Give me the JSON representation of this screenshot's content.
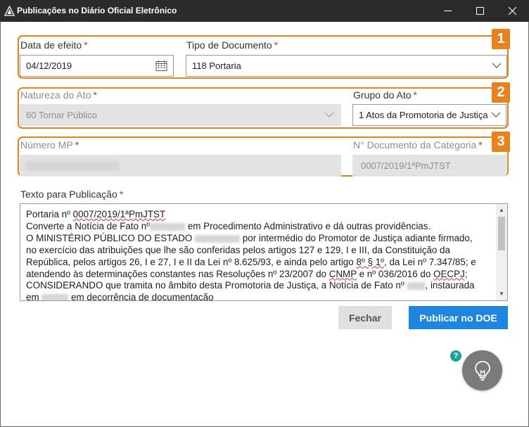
{
  "window": {
    "title": "Publicações no Diário Oficial Eletrônico",
    "icons": {
      "app": "app-logo-icon",
      "minimize": "minimize-icon",
      "maximize": "maximize-icon",
      "close": "close-icon"
    }
  },
  "section1": {
    "badge": "1",
    "data_efeito": {
      "label": "Data de efeito",
      "required_mark": "*",
      "value": "04/12/2019",
      "icon": "calendar-icon"
    },
    "tipo_documento": {
      "label": "Tipo de Documento",
      "required_mark": "*",
      "value": "118 Portaria",
      "icon": "chevron-down-icon"
    }
  },
  "section2": {
    "badge": "2",
    "natureza_ato": {
      "label": "Natureza do Ato",
      "required_mark": "*",
      "value": "60 Tornar Público",
      "icon": "chevron-down-icon"
    },
    "grupo_ato": {
      "label": "Grupo do Ato",
      "required_mark": "*",
      "value": "1 Atos da Promotoria de Justiça",
      "icon": "chevron-down-icon"
    }
  },
  "section3": {
    "badge": "3",
    "numero_mp": {
      "label": "Número MP",
      "required_mark": "*"
    },
    "documento_categoria": {
      "label": "N° Documento da Categoria",
      "required_mark": "*",
      "value": "0007/2019/1ªPmJTST"
    }
  },
  "texto": {
    "label": "Texto para Publicação",
    "required_mark": "*",
    "line1": {
      "a": "Portaria nº ",
      "b": "0007/2019/1ªPmJTST"
    },
    "line2": {
      "a": "Converte a Notícia de Fato nº",
      "b": " em Procedimento Administrativo e dá outras providências."
    },
    "line3": {
      "a": "O MINISTÉRIO PÚBLICO DO ESTADO ",
      "b": " por intermédio do Promotor de Justiça adiante firmado,"
    },
    "line4": "no exercício das atribuições que lhe são conferidas pelos artigos 127 e 129, I e III, da Constituição da",
    "line5": {
      "a": "República, pelos artigos 26, I e 27, I e II da Lei nº 8.625/93, e ainda pelo artigo ",
      "b": "8º § 1º",
      "c": ", da Lei nº 7.347/85; e"
    },
    "line6": {
      "a": "atendendo às determinações constantes nas Resoluções nº 23/2007 do ",
      "b": "CNMP",
      "c": " e nº 036/2016 do ",
      "d": "OECPJ",
      "e": ";"
    },
    "line7": {
      "a": "CONSIDERANDO que tramita no âmbito desta Promotoria de Justiça, a Notícia de Fato nº ",
      "b": ", instaurada"
    },
    "line8": {
      "a": "em ",
      "b": " em decorrência de documentação"
    },
    "scroll_up": "▲",
    "scroll_down": "▼"
  },
  "buttons": {
    "fechar": "Fechar",
    "publicar": "Publicar no DOE"
  },
  "help": {
    "label": "?",
    "icon": "help-icon"
  },
  "lightbulb": {
    "icon": "lightbulb-icon"
  },
  "colors": {
    "accent_orange": "#e8821f",
    "primary_blue": "#1f86e0",
    "titlebar": "#2b2b2b",
    "required_red": "#d0312d"
  }
}
